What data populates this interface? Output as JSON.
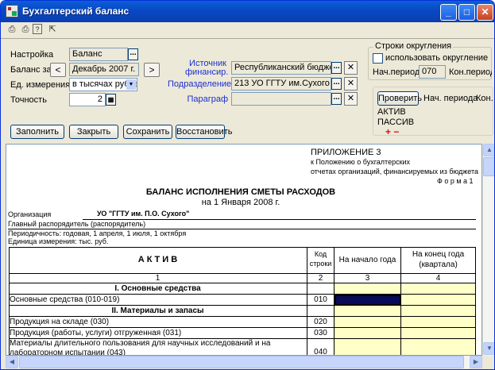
{
  "window": {
    "title": "Бухгалтерский баланс",
    "controls": {
      "minimize": "_",
      "maximize": "□",
      "close": "✕"
    }
  },
  "toolbar": {
    "icons": [
      "printer-icon",
      "printer-setup-icon",
      "help-icon",
      "pointer-help-icon"
    ]
  },
  "form": {
    "settings_label": "Настройка",
    "settings_value": "Баланс",
    "balance_label": "Баланс за",
    "balance_value": "Декабрь 2007 г.",
    "prev": "<",
    "next": ">",
    "units_label": "Ед. измерения",
    "units_value": "в тысячах рублей",
    "precision_label": "Точность",
    "precision_value": "2",
    "source_label": "Источник финансир.",
    "source_value": "Республиканский бюджет",
    "division_label": "Подразделение",
    "division_value": "213 УО ГГТУ им.Сухого",
    "paragraph_label": "Параграф",
    "paragraph_value": "",
    "dots": "...",
    "clear": "✕"
  },
  "rounding": {
    "title": "Строки округления",
    "checkbox_label": "использовать округление",
    "start_label": "Нач.периода",
    "start_value": "070",
    "end_label": "Кон.периода"
  },
  "check": {
    "button": "Проверить",
    "col1": "Нач. периода",
    "col2": "Кон.",
    "items": [
      "АКТИВ",
      "ПАССИВ"
    ],
    "plus_minus": "+ −"
  },
  "buttons": {
    "fill": "Заполнить",
    "close": "Закрыть",
    "save": "Сохранить",
    "restore": "Восстановить"
  },
  "document": {
    "appendix": "ПРИЛОЖЕНИЕ 3",
    "appendix_sub1": "к Положению о бухгалтерских",
    "appendix_sub2": "отчетах организаций, финансируемых из бюджета",
    "form_no": "Ф о р м а 1",
    "title": "БАЛАНС ИСПОЛНЕНИЯ СМЕТЫ РАСХОДОВ",
    "date": "на 1 Января 2008 г.",
    "org_label": "Организация",
    "org_value": "УО \"ГГТУ им. П.О. Сухого\"",
    "manager": "Главный распорядитель (распорядитель)",
    "periodicity": "Периодичность: годовая, 1 апреля, 1 июля, 1 октября",
    "unit": "Единица измерения: тыс. руб.",
    "table": {
      "col_asset": "А К Т И В",
      "col_code": "Код строки",
      "col_start": "На начало года",
      "col_end": "На конец года (квартала)",
      "nums": [
        "1",
        "2",
        "3",
        "4"
      ],
      "rows": [
        {
          "label": "I. Основные средства",
          "code": "",
          "section": true
        },
        {
          "label": "Основные средства (010-019)",
          "code": "010"
        },
        {
          "label": "II. Материалы и запасы",
          "code": "",
          "section": true
        },
        {
          "label": "Продукция на складе (030)",
          "code": "020"
        },
        {
          "label": "Продукция (работы, услуги) отгруженная (031)",
          "code": "030"
        },
        {
          "label": "Материалы длительного пользования для научных исследований и на",
          "label2": "лабораторном испытании (043)",
          "code": "040"
        }
      ]
    }
  }
}
